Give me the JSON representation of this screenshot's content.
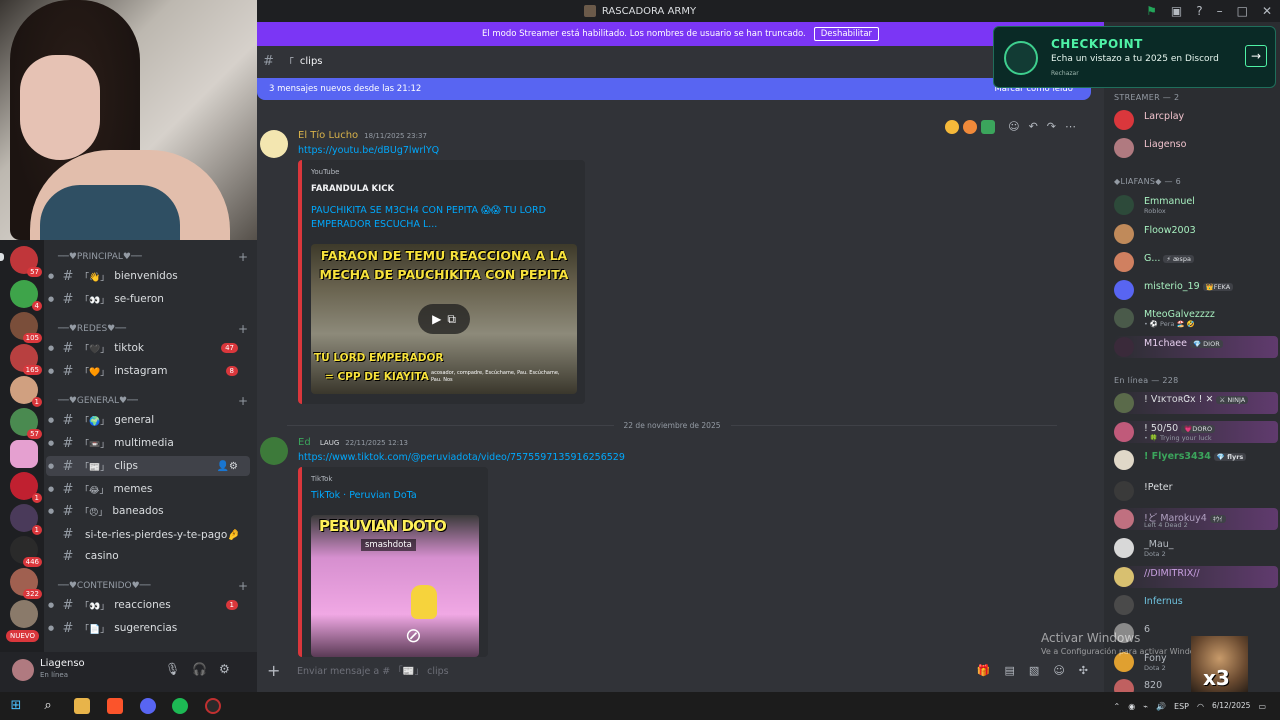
{
  "titlebar": {
    "title": "RASCADORA ARMY"
  },
  "streamer_bar": {
    "text": "El modo Streamer está habilitado. Los nombres de usuario se han truncado.",
    "button": "Deshabilitar"
  },
  "channel_header": {
    "box": "「",
    "name": "clips"
  },
  "new_messages_bar": {
    "text": "3 mensajes nuevos desde las 21:12",
    "mark_read": "Marcar como leído"
  },
  "categories": {
    "principal": "──♥PRINCIPAL♥──",
    "redes": "──♥REDES♥──",
    "general": "──♥GENERAL♥──",
    "contenido": "──♥CONTENIDO♥──"
  },
  "channels": [
    {
      "prefix": "「👋」",
      "name": "bienvenidos",
      "badge": ""
    },
    {
      "prefix": "「👀」",
      "name": "se-fueron",
      "badge": ""
    },
    {
      "prefix": "「🖤」",
      "name": "tiktok",
      "badge": "47"
    },
    {
      "prefix": "「🧡」",
      "name": "instagram",
      "badge": "8"
    },
    {
      "prefix": "「🌍」",
      "name": "general",
      "badge": ""
    },
    {
      "prefix": "「📼」",
      "name": "multimedia",
      "badge": ""
    },
    {
      "prefix": "「📰」",
      "name": "clips",
      "badge": ""
    },
    {
      "prefix": "「😂」",
      "name": "memes",
      "badge": ""
    },
    {
      "prefix": "「😠」",
      "name": "baneados",
      "badge": ""
    },
    {
      "prefix": "",
      "name": "si-te-ries-pierdes-y-te-pago🤌",
      "badge": ""
    },
    {
      "prefix": "",
      "name": "casino",
      "badge": ""
    },
    {
      "prefix": "「👀」",
      "name": "reacciones",
      "badge": "1"
    },
    {
      "prefix": "「📄」",
      "name": "sugerencias",
      "badge": ""
    }
  ],
  "server_badges": [
    "57",
    "4",
    "105",
    "165",
    "1",
    "57",
    "1",
    "1",
    "446",
    "322"
  ],
  "nuevo_label": "NUEVO",
  "user_panel": {
    "name": "Liagenso",
    "status": "En línea"
  },
  "messages": [
    {
      "author": "El Tío Lucho",
      "time": "18/11/2025 23:37",
      "link": "https://youtu.be/dBUg7lwrlYQ",
      "embed": {
        "provider": "YouTube",
        "author": "FARANDULA KICK",
        "title": "PAUCHIKITA SE M3CH4 CON PEPITA 😱😱 TU LORD EMPERADOR ESCUCHA L...",
        "caption_top": "FARAON DE TEMU REACCIONA A LA MECHA DE PAUCHIKITA CON PEPITA",
        "caption_bottom_1": "TU LORD EMPERADOR",
        "caption_bottom_2": "= CPP DE KIAYITA",
        "caption_small": "acosador, compadre, Escúchame, Pau. Escúchame, Pau. Nos"
      }
    },
    {
      "author": "Ed",
      "tag": "LAUG",
      "time": "22/11/2025 12:13",
      "link": "https://www.tiktok.com/@peruviadota/video/7575597135916256529",
      "embed": {
        "provider": "TikTok",
        "title": "TikTok · Peruvian DoTa",
        "caption": "PERUVIAN DOTO",
        "handle": "smashdota"
      }
    }
  ],
  "date_divider": "22 de noviembre de 2025",
  "composer": {
    "placeholder": "Enviar mensaje a # 「📰」 clips"
  },
  "members": {
    "streamer_header": "STREAMER — 2",
    "streamers": [
      {
        "name": "Larcplay",
        "status": ""
      },
      {
        "name": "Liagenso",
        "status": ""
      }
    ],
    "liafans_header": "◆LIAFANS◆ — 6",
    "liafans": [
      {
        "name": "Emmanuel",
        "status": "Roblox",
        "tag": ""
      },
      {
        "name": "Floow2003",
        "status": "",
        "tag": ""
      },
      {
        "name": "G...",
        "status": "",
        "tag": "⚡ æspa"
      },
      {
        "name": "misterio_19",
        "status": "",
        "tag": "👑FEKA"
      },
      {
        "name": "MteoGalvezzzz",
        "status": "• ⚽ Pera 🏖️ 🤣",
        "tag": ""
      },
      {
        "name": "M1chaee",
        "status": "",
        "tag": "💎 DIOR"
      }
    ],
    "online_header": "En línea — 228",
    "online": [
      {
        "name": "! VɪᴋᴛᴏʀᏣx ! ✕",
        "status": "",
        "tag": "⚔ NINJA"
      },
      {
        "name": "! 50/50",
        "status": "• 🍀 Trying your luck",
        "tag": "💗DORO"
      },
      {
        "name": "! Flyers3434",
        "status": "",
        "tag": "💎 flyrs"
      },
      {
        "name": "!Peter",
        "status": "",
        "tag": ""
      },
      {
        "name": "!ど Marokuy4",
        "status": "Left 4 Dead 2",
        "tag": "ｷｳｲ"
      },
      {
        "name": "_Mau_",
        "status": "Dota 2",
        "tag": ""
      },
      {
        "name": "//DIMITRIX//",
        "status": "",
        "tag": ""
      },
      {
        "name": "Infernus",
        "status": "",
        "tag": ""
      },
      {
        "name": "6",
        "status": "",
        "tag": ""
      },
      {
        "name": "Fony",
        "status": "Dota 2",
        "tag": ""
      },
      {
        "name": "820",
        "status": "",
        "tag": ""
      }
    ]
  },
  "checkpoint": {
    "heading": "CHECKPOINT",
    "text": "Echa un vistazo a tu 2025 en Discord",
    "dismiss": "Rechazar"
  },
  "windows_activation": {
    "title": "Activar Windows",
    "subtitle": "Ve a Configuración para activar Windows."
  },
  "meme_overlay": "x3",
  "taskbar": {
    "lang": "ESP",
    "time": "",
    "date": "6/12/2025"
  }
}
